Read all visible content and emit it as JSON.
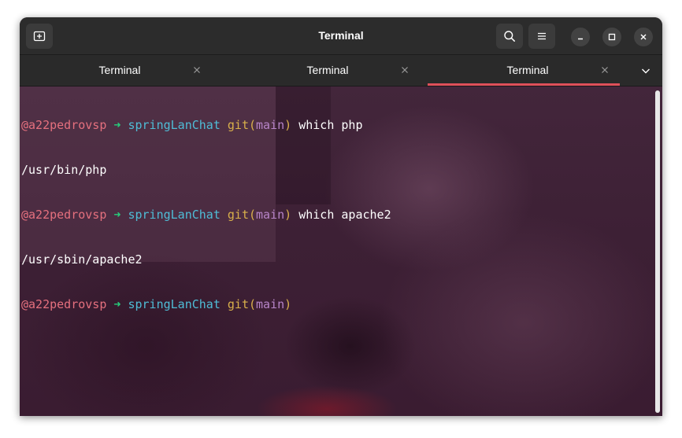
{
  "window": {
    "title": "Terminal"
  },
  "headerbar": {
    "new_tab_icon": "new-tab-icon",
    "search_icon": "search-icon",
    "menu_icon": "hamburger-menu-icon",
    "minimize_icon": "minimize-icon",
    "maximize_icon": "maximize-icon",
    "close_icon": "close-icon"
  },
  "tabs": [
    {
      "label": "Terminal",
      "active": false
    },
    {
      "label": "Terminal",
      "active": false
    },
    {
      "label": "Terminal",
      "active": true
    }
  ],
  "terminal": {
    "lines": [
      {
        "type": "prompt",
        "user": "@a22pedrovsp",
        "arrow": "➜",
        "dir": "springLanChat",
        "git": "git",
        "open": "(",
        "branch": "main",
        "close": ")",
        "command": " which php"
      },
      {
        "type": "output",
        "text": "/usr/bin/php"
      },
      {
        "type": "prompt",
        "user": "@a22pedrovsp",
        "arrow": "➜",
        "dir": "springLanChat",
        "git": "git",
        "open": "(",
        "branch": "main",
        "close": ")",
        "command": " which apache2"
      },
      {
        "type": "output",
        "text": "/usr/sbin/apache2"
      },
      {
        "type": "prompt",
        "user": "@a22pedrovsp",
        "arrow": "➜",
        "dir": "springLanChat",
        "git": "git",
        "open": "(",
        "branch": "main",
        "close": ")",
        "command": ""
      }
    ]
  },
  "colors": {
    "accent_tab": "#e0505a",
    "user": "#e5707e",
    "arrow": "#26d07c",
    "dir": "#4fbcd6",
    "git": "#d9b04b",
    "branch": "#b785c9"
  }
}
